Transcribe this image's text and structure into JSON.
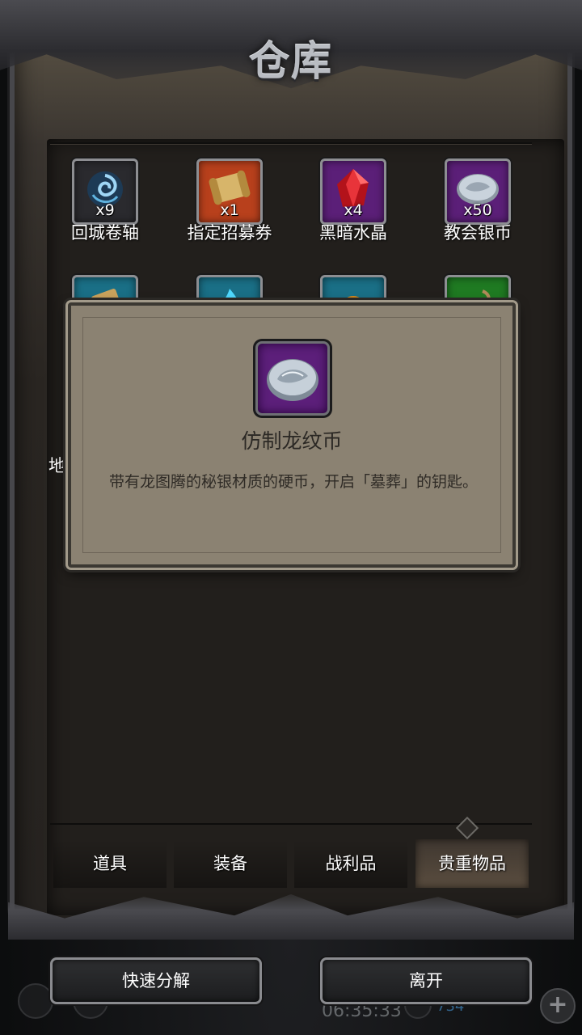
{
  "window": {
    "title": "仓库"
  },
  "items": [
    {
      "name": "回城卷轴",
      "count": "x9",
      "icon": "swirl-scroll-icon",
      "frame": "#2a2a2e"
    },
    {
      "name": "指定招募券",
      "count": "x1",
      "icon": "parchment-scroll-icon",
      "frame": "#b8401c"
    },
    {
      "name": "黑暗水晶",
      "count": "x4",
      "icon": "red-crystal-icon",
      "frame": "#5b1f78"
    },
    {
      "name": "教会银币",
      "count": "x50",
      "icon": "silver-coin-icon",
      "frame": "#5b1f78"
    }
  ],
  "partial_items": [
    {
      "icon": "map-scroll-icon",
      "frame": "#1a6f86"
    },
    {
      "icon": "blue-flame-icon",
      "frame": "#1a6f86"
    },
    {
      "icon": "gold-orb-icon",
      "frame": "#1a6f86"
    },
    {
      "icon": "pouch-icon",
      "frame": "#1f7a22"
    }
  ],
  "left_peek_text": "地",
  "popup": {
    "item_name": "仿制龙纹币",
    "icon": "dragon-coin-icon",
    "description": "带有龙图腾的秘银材质的硬币，开启「墓葬」的钥匙。"
  },
  "tabs": [
    {
      "label": "道具",
      "active": false
    },
    {
      "label": "装备",
      "active": false
    },
    {
      "label": "战利品",
      "active": false
    },
    {
      "label": "贵重物品",
      "active": true
    }
  ],
  "buttons": {
    "quick_decompose": "快速分解",
    "leave": "离开"
  },
  "hud": {
    "clock": "06:35:33",
    "resource": "734"
  },
  "colors": {
    "purple_frame": "#5b1f78",
    "popup_bg": "#8b8272",
    "text_light": "#ffffff"
  }
}
